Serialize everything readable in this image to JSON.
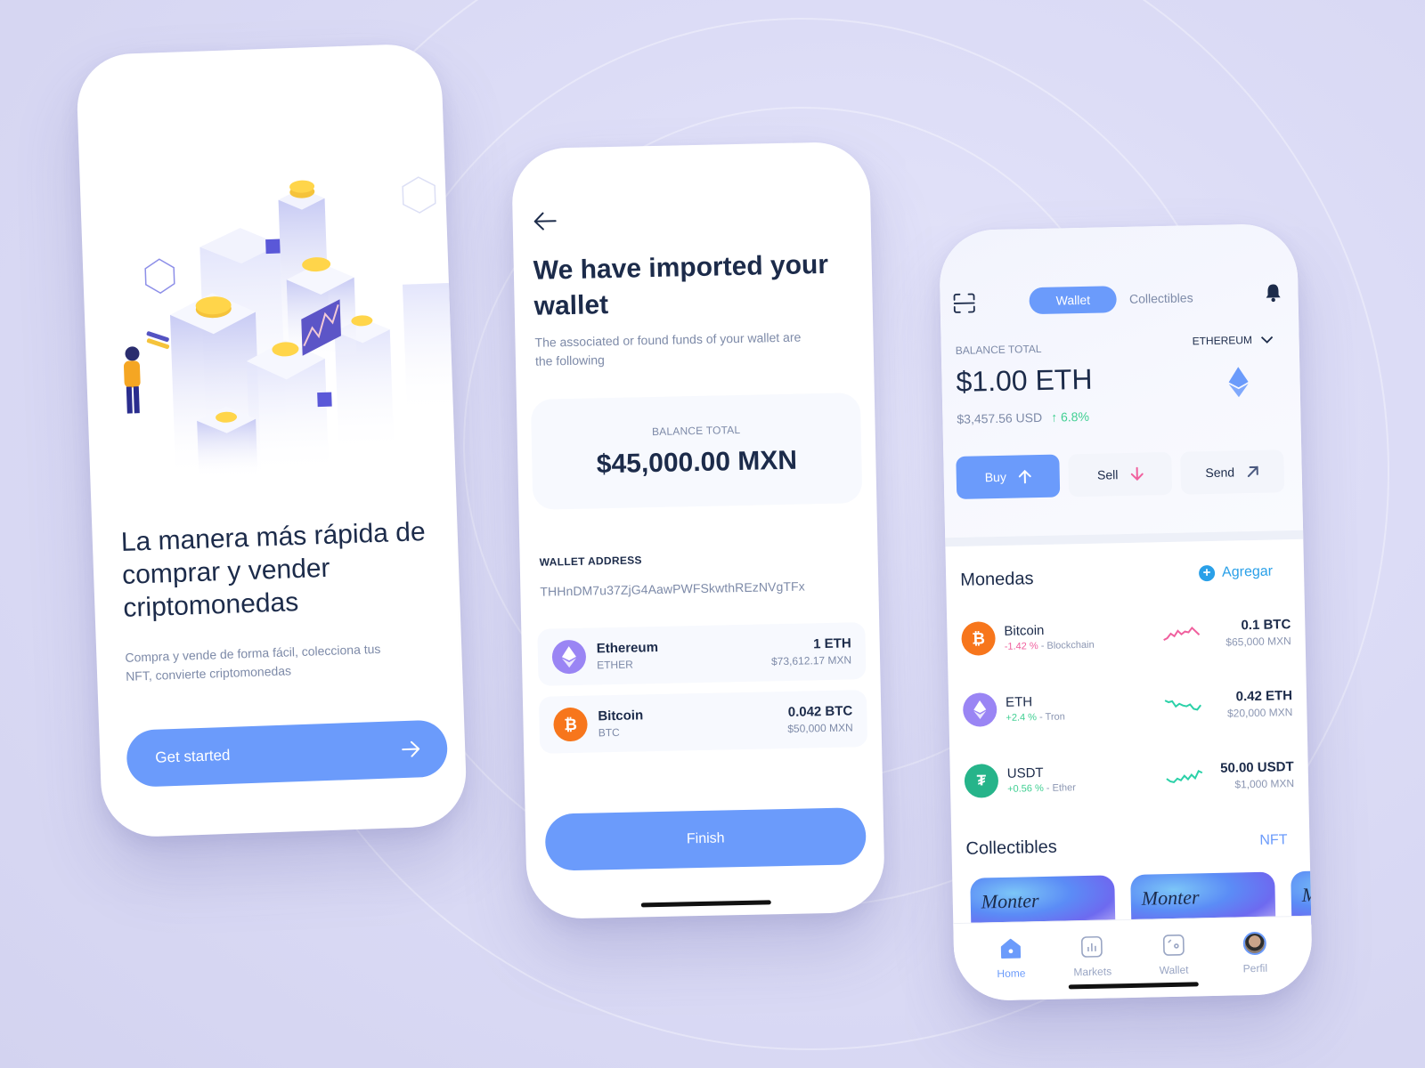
{
  "colors": {
    "accent": "#6b9bfb",
    "text_dark": "#1c2b4a",
    "text_muted": "#7d8aa8",
    "positive": "#3fcf92",
    "negative": "#f0609e",
    "link": "#2aa0e8",
    "bitcoin": "#f7761c",
    "ethereum": "#9a85f4",
    "tether": "#26b48a"
  },
  "onboarding": {
    "illustration": "isometric-crypto-buildings-illustration",
    "title": "La manera más rápida de comprar y vender criptomonedas",
    "subtitle": "Compra y vende de forma fácil, colecciona tus NFT, convierte criptomonedas",
    "cta_label": "Get started",
    "cta_icon": "arrow-right-icon"
  },
  "import": {
    "back_icon": "arrow-left-icon",
    "title": "We have imported your wallet",
    "subtitle": "The associated or found funds of your wallet are the following",
    "balance_label": "BALANCE TOTAL",
    "balance_value": "$45,000.00 MXN",
    "address_label": "WALLET ADDRESS",
    "address_value": "THHnDM7u37ZjG4AawPWFSkwthREzNVgTFx",
    "assets": [
      {
        "name": "Ethereum",
        "symbol": "ETHER",
        "amount": "1 ETH",
        "fiat": "$73,612.17 MXN",
        "icon": "ethereum-icon"
      },
      {
        "name": "Bitcoin",
        "symbol": "BTC",
        "amount": "0.042 BTC",
        "fiat": "$50,000 MXN",
        "icon": "bitcoin-icon"
      }
    ],
    "finish_label": "Finish"
  },
  "home": {
    "tabs": [
      {
        "label": "Wallet",
        "active": true
      },
      {
        "label": "Collectibles",
        "active": false
      }
    ],
    "balance_label": "BALANCE TOTAL",
    "network": "ETHEREUM",
    "balance_value": "$1.00 ETH",
    "balance_usd": "$3,457.56 USD",
    "balance_change": "6.8%",
    "actions": [
      {
        "label": "Buy",
        "icon": "arrow-up-icon"
      },
      {
        "label": "Sell",
        "icon": "arrow-down-icon"
      },
      {
        "label": "Send",
        "icon": "arrow-up-right-icon"
      }
    ],
    "coins_title": "Monedas",
    "add_label": "Agregar",
    "coins": [
      {
        "name": "Bitcoin",
        "change": "-1.42 %",
        "network": " - Blockchain",
        "amount": "0.1 BTC",
        "fiat": "$65,000 MXN",
        "trend": "negative",
        "icon": "bitcoin-icon"
      },
      {
        "name": "ETH",
        "change": "+2.4 %",
        "network": " - Tron",
        "amount": "0.42 ETH",
        "fiat": "$20,000 MXN",
        "trend": "positive",
        "icon": "ethereum-icon"
      },
      {
        "name": "USDT",
        "change": "+0.56 %",
        "network": " - Ether",
        "amount": "50.00 USDT",
        "fiat": "$1,000 MXN",
        "trend": "positive",
        "icon": "tether-icon"
      }
    ],
    "collectibles_title": "Collectibles",
    "nft_link": "NFT",
    "nfts": [
      {
        "title": "Monter"
      },
      {
        "title": "Monter"
      },
      {
        "title": "M"
      }
    ],
    "nav": [
      {
        "label": "Home",
        "icon": "home-icon",
        "active": true
      },
      {
        "label": "Markets",
        "icon": "markets-icon",
        "active": false
      },
      {
        "label": "Wallet",
        "icon": "wallet-icon",
        "active": false
      },
      {
        "label": "Perfil",
        "icon": "avatar",
        "active": false
      }
    ]
  }
}
